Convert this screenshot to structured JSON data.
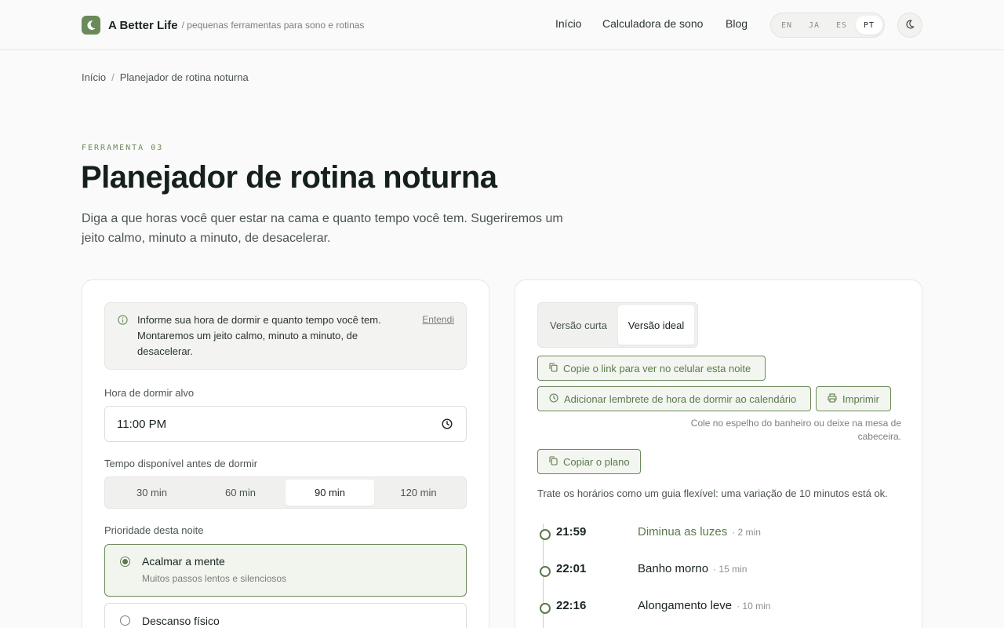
{
  "header": {
    "brand_name": "A Better Life",
    "brand_tagline": "/ pequenas ferramentas para sono e rotinas",
    "nav": [
      {
        "label": "Início"
      },
      {
        "label": "Calculadora de sono"
      },
      {
        "label": "Blog"
      }
    ],
    "languages": [
      {
        "label": "EN",
        "active": false
      },
      {
        "label": "JA",
        "active": false
      },
      {
        "label": "ES",
        "active": false
      },
      {
        "label": "PT",
        "active": true
      }
    ],
    "theme_toggle_icon": "moon-icon"
  },
  "breadcrumb": {
    "home": "Início",
    "separator": "/",
    "current": "Planejador de rotina noturna"
  },
  "hero": {
    "eyebrow": "FERRAMENTA 03",
    "title": "Planejador de rotina noturna",
    "subtitle": "Diga a que horas você quer estar na cama e quanto tempo você tem. Sugeriremos um jeito calmo, minuto a minuto, de desacelerar."
  },
  "form": {
    "info": {
      "text": "Informe sua hora de dormir e quanto tempo você tem. Montaremos um jeito calmo, minuto a minuto, de desacelerar.",
      "dismiss": "Entendi"
    },
    "bedtime": {
      "label": "Hora de dormir alvo",
      "value": "11:00 PM"
    },
    "available_time": {
      "label": "Tempo disponível antes de dormir",
      "options": [
        {
          "label": "30 min",
          "active": false
        },
        {
          "label": "60 min",
          "active": false
        },
        {
          "label": "90 min",
          "active": true
        },
        {
          "label": "120 min",
          "active": false
        }
      ]
    },
    "priority": {
      "label": "Prioridade desta noite",
      "options": [
        {
          "title": "Acalmar a mente",
          "subtitle": "Muitos passos lentos e silenciosos",
          "selected": true
        },
        {
          "title": "Descanso físico",
          "subtitle": "",
          "selected": false
        }
      ]
    }
  },
  "plan": {
    "versions": [
      {
        "label": "Versão curta",
        "active": false
      },
      {
        "label": "Versão ideal",
        "active": true
      }
    ],
    "actions": {
      "copy_link": "Copie o link para ver no celular esta noite",
      "add_reminder": "Adicionar lembrete de hora de dormir ao calendário",
      "print": "Imprimir",
      "copy_plan": "Copiar o plano"
    },
    "print_hint": "Cole no espelho do banheiro ou deixe na mesa de cabeceira.",
    "flex_note": "Trate os horários como um guia flexível: uma variação de 10 minutos está ok.",
    "steps": [
      {
        "time": "21:59",
        "task": "Diminua as luzes",
        "duration": "· 2 min",
        "highlight": true
      },
      {
        "time": "22:01",
        "task": "Banho morno",
        "duration": "· 15 min",
        "highlight": false
      },
      {
        "time": "22:16",
        "task": "Alongamento leve",
        "duration": "· 10 min",
        "highlight": false
      }
    ]
  },
  "colors": {
    "accent": "#6b8a5a",
    "accent_dark": "#5b7a4d",
    "background": "#fafafa"
  }
}
